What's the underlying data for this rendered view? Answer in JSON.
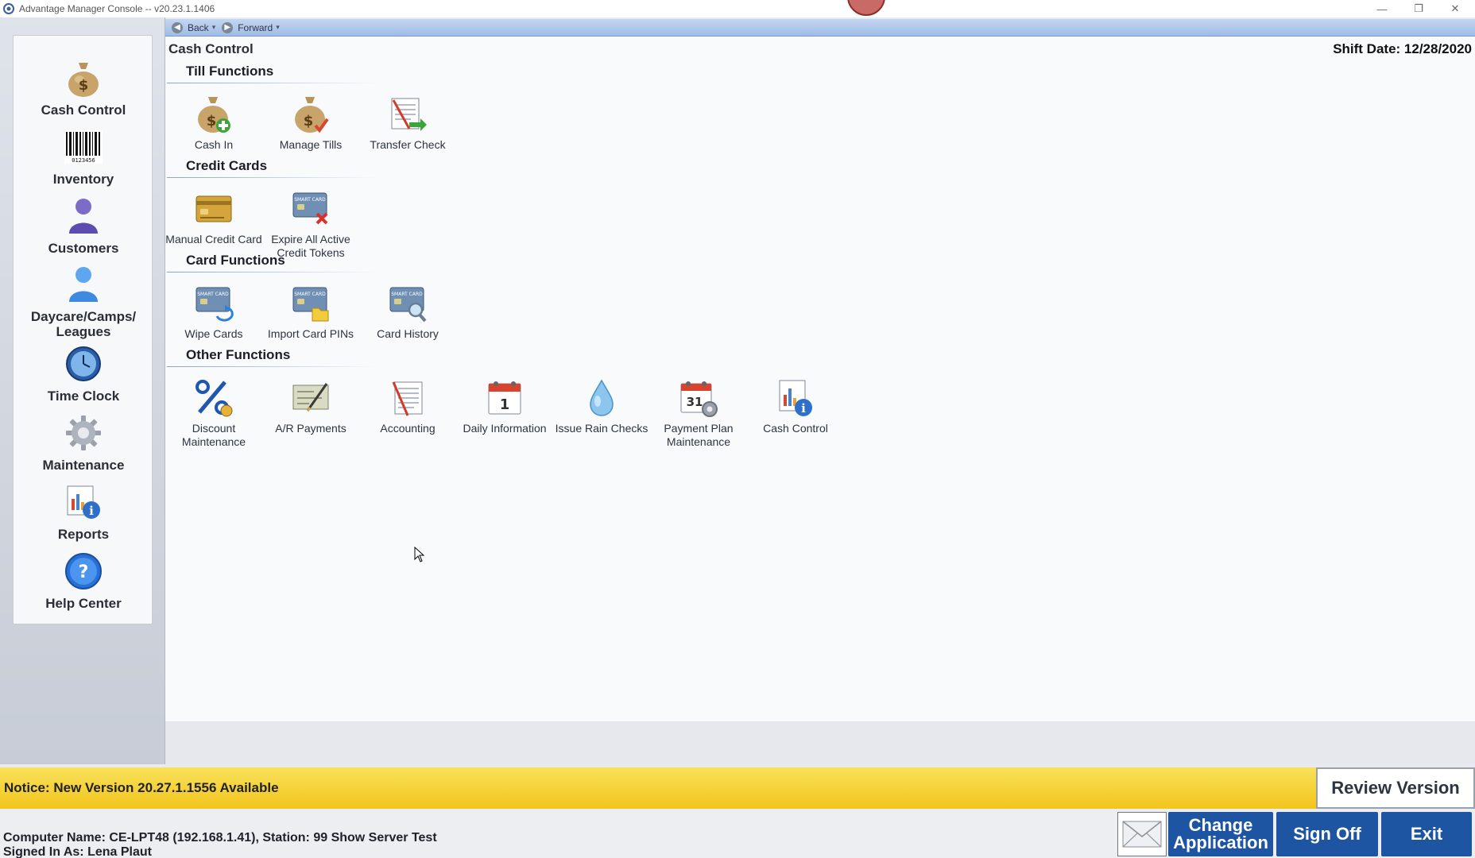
{
  "window": {
    "title": "Advantage Manager Console -- v20.23.1.1406",
    "minimize": "—",
    "restore": "❐",
    "close": "✕"
  },
  "nav": {
    "back_label": "Back",
    "forward_label": "Forward"
  },
  "sidebar": {
    "items": [
      {
        "label": "Cash Control",
        "icon": "money-bag-icon"
      },
      {
        "label": "Inventory",
        "icon": "barcode-icon"
      },
      {
        "label": "Customers",
        "icon": "person-icon"
      },
      {
        "label": "Daycare/Camps/ Leagues",
        "icon": "person-blue-icon"
      },
      {
        "label": "Time Clock",
        "icon": "clock-icon"
      },
      {
        "label": "Maintenance",
        "icon": "gear-icon"
      },
      {
        "label": "Reports",
        "icon": "report-icon"
      },
      {
        "label": "Help Center",
        "icon": "help-icon"
      }
    ]
  },
  "main": {
    "page_title": "Cash Control",
    "shift_date": "Shift Date: 12/28/2020",
    "sections": [
      {
        "title": "Till Functions",
        "tiles": [
          {
            "label": "Cash In",
            "icon": "cash-in-icon"
          },
          {
            "label": "Manage Tills",
            "icon": "manage-tills-icon"
          },
          {
            "label": "Transfer Check",
            "icon": "transfer-check-icon"
          }
        ]
      },
      {
        "title": "Credit Cards",
        "tiles": [
          {
            "label": "Manual Credit Card",
            "icon": "credit-card-icon"
          },
          {
            "label": "Expire All Active Credit Tokens",
            "icon": "expire-card-icon"
          }
        ]
      },
      {
        "title": "Card Functions",
        "tiles": [
          {
            "label": "Wipe Cards",
            "icon": "wipe-card-icon"
          },
          {
            "label": "Import Card PINs",
            "icon": "import-card-icon"
          },
          {
            "label": "Card History",
            "icon": "card-history-icon"
          }
        ]
      },
      {
        "title": "Other Functions",
        "tiles": [
          {
            "label": "Discount Maintenance",
            "icon": "percent-icon"
          },
          {
            "label": "A/R Payments",
            "icon": "check-pen-icon"
          },
          {
            "label": "Accounting",
            "icon": "accounting-icon"
          },
          {
            "label": "Daily Information",
            "icon": "calendar-icon"
          },
          {
            "label": "Issue Rain Checks",
            "icon": "raindrop-icon"
          },
          {
            "label": "Payment Plan Maintenance",
            "icon": "calendar-gear-icon"
          },
          {
            "label": "Cash Control",
            "icon": "report-info-icon"
          }
        ]
      }
    ]
  },
  "notice": {
    "text": "Notice: New Version 20.27.1.1556 Available",
    "review_button": "Review Version"
  },
  "status": {
    "computer": "Computer Name: CE-LPT48 (192.168.1.41), Station: 99 Show Server Test",
    "signed_in": "Signed In As: Lena Plaut",
    "change_app_line1": "Change",
    "change_app_line2": "Application",
    "sign_off": "Sign Off",
    "exit": "Exit"
  },
  "colors": {
    "accent_blue": "#1d55a3",
    "notice_yellow": "#f5d33a",
    "nav_blue": "#b3cbee"
  }
}
